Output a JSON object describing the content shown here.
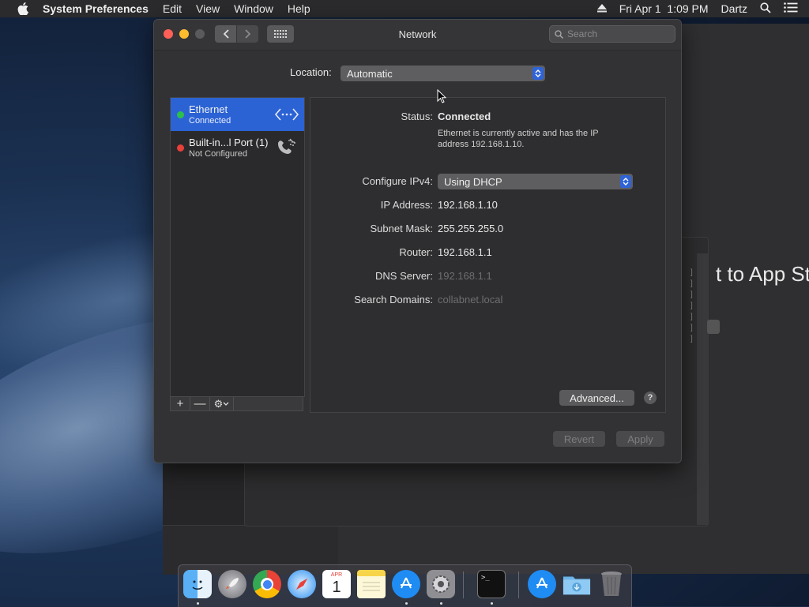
{
  "menubar": {
    "app_name": "System Preferences",
    "menus": [
      "Edit",
      "View",
      "Window",
      "Help"
    ],
    "clock": "Fri Apr 1  1:09 PM",
    "user": "Dartz"
  },
  "window": {
    "title": "Network",
    "search_placeholder": "Search"
  },
  "location": {
    "label": "Location:",
    "value": "Automatic"
  },
  "services": [
    {
      "name": "Ethernet",
      "status": "Connected",
      "status_color": "#2dbf4a",
      "selected": true,
      "icon": "ethernet-icon"
    },
    {
      "name": "Built-in...l Port (1)",
      "status": "Not Configured",
      "status_color": "#e8403a",
      "selected": false,
      "icon": "phone-modem-icon"
    }
  ],
  "sidebar_toolbar": {
    "add": "+",
    "remove": "—",
    "action": "⚙"
  },
  "details": {
    "status_label": "Status:",
    "status_value": "Connected",
    "status_desc": "Ethernet is currently active and has the IP address 192.168.1.10.",
    "configure_label": "Configure IPv4:",
    "configure_value": "Using DHCP",
    "ip_label": "IP Address:",
    "ip_value": "192.168.1.10",
    "subnet_label": "Subnet Mask:",
    "subnet_value": "255.255.255.0",
    "router_label": "Router:",
    "router_value": "192.168.1.1",
    "dns_label": "DNS Server:",
    "dns_value": "192.168.1.1",
    "search_domains_label": "Search Domains:",
    "search_domains_value": "collabnet.local",
    "advanced_button": "Advanced...",
    "help_button": "?"
  },
  "footer": {
    "revert": "Revert",
    "apply": "Apply"
  },
  "background": {
    "text": "t to App Sto"
  },
  "dock": {
    "apps": [
      "Finder",
      "Launchpad",
      "Chrome",
      "Safari",
      "Calendar",
      "Notes",
      "App Store",
      "System Preferences",
      "Terminal",
      "App Store",
      "Downloads",
      "Trash"
    ],
    "calendar_month": "APR",
    "calendar_day": "1"
  }
}
